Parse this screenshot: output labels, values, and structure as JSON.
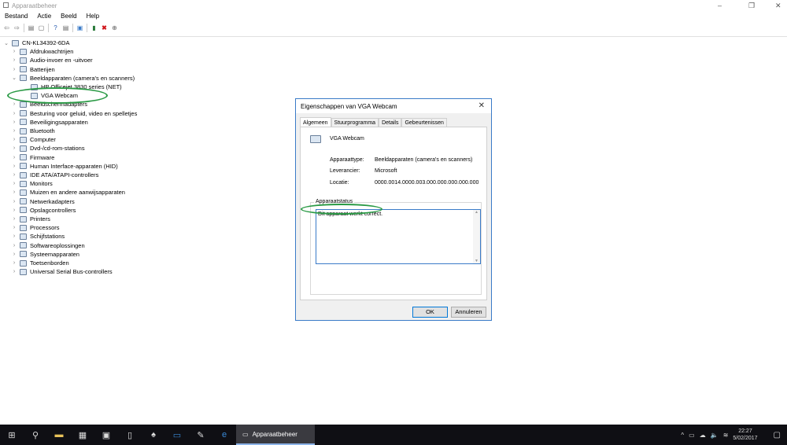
{
  "window": {
    "title": "Apparaatbeheer",
    "min": "–",
    "max": "❐",
    "close": "✕"
  },
  "menu": [
    "Bestand",
    "Actie",
    "Beeld",
    "Help"
  ],
  "tree": {
    "root": "CN-KL34392-6DA",
    "items": [
      {
        "label": "Afdrukwachtrijen",
        "expanded": false
      },
      {
        "label": "Audio-invoer en -uitvoer",
        "expanded": false
      },
      {
        "label": "Batterijen",
        "expanded": false
      },
      {
        "label": "Beeldapparaten (camera's en scanners)",
        "expanded": true,
        "children": [
          "HP Officejet 3830 series (NET)",
          "VGA Webcam"
        ]
      },
      {
        "label": "Beeldschermadapters",
        "expanded": false
      },
      {
        "label": "Besturing voor geluid, video en spelletjes",
        "expanded": false
      },
      {
        "label": "Beveiligingsapparaten",
        "expanded": false
      },
      {
        "label": "Bluetooth",
        "expanded": false
      },
      {
        "label": "Computer",
        "expanded": false
      },
      {
        "label": "Dvd-/cd-rom-stations",
        "expanded": false
      },
      {
        "label": "Firmware",
        "expanded": false
      },
      {
        "label": "Human Interface-apparaten (HID)",
        "expanded": false
      },
      {
        "label": "IDE ATA/ATAPI-controllers",
        "expanded": false
      },
      {
        "label": "Monitors",
        "expanded": false
      },
      {
        "label": "Muizen en andere aanwijsapparaten",
        "expanded": false
      },
      {
        "label": "Netwerkadapters",
        "expanded": false
      },
      {
        "label": "Opslagcontrollers",
        "expanded": false
      },
      {
        "label": "Printers",
        "expanded": false
      },
      {
        "label": "Processors",
        "expanded": false
      },
      {
        "label": "Schijfstations",
        "expanded": false
      },
      {
        "label": "Softwareoplossingen",
        "expanded": false
      },
      {
        "label": "Systeemapparaten",
        "expanded": false
      },
      {
        "label": "Toetsenborden",
        "expanded": false
      },
      {
        "label": "Universal Serial Bus-controllers",
        "expanded": false
      }
    ]
  },
  "dialog": {
    "title": "Eigenschappen van VGA Webcam",
    "tabs": [
      "Algemeen",
      "Stuurprogramma",
      "Details",
      "Gebeurtenissen"
    ],
    "device_name": "VGA Webcam",
    "props": [
      {
        "label": "Apparaattype:",
        "value": "Beeldapparaten (camera's en scanners)"
      },
      {
        "label": "Leverancier:",
        "value": "Microsoft"
      },
      {
        "label": "Locatie:",
        "value": "0000.0014.0000.003.000.000.000.000.000"
      }
    ],
    "status_label": "Apparaatstatus",
    "status_text": "Dit apparaat werkt correct.",
    "ok": "OK",
    "cancel": "Annuleren"
  },
  "taskbar": {
    "active_app": "Apparaatbeheer",
    "time": "22:27",
    "date": "5/02/2017"
  },
  "colors": {
    "highlight": "#2a9a45",
    "accent": "#0078d7"
  }
}
